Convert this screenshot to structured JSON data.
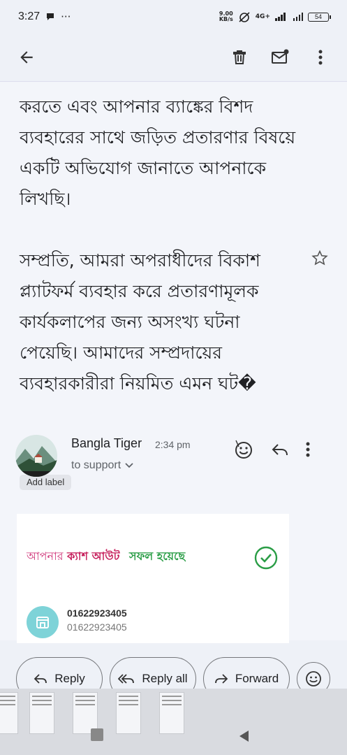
{
  "status_bar": {
    "time": "3:27",
    "ellipsis": "···",
    "speed_value": "9.00",
    "speed_unit": "KB/s",
    "network": "4G+",
    "battery": "54"
  },
  "email": {
    "paragraph_1": "করতে এবং আপনার ব্যাঙ্কের বিশদ ব্যবহারের সাথে জড়িত প্রতারণার বিষয়ে একটি অভিযোগ জানাতে আপনাকে লিখছি।",
    "paragraph_2": "সম্প্রতি, আমরা অপরাধীদের বিকাশ প্ল্যাটফর্ম ব্যবহার করে প্রতারণামূলক কার্যকলাপের জন্য অসংখ্য ঘটনা পেয়েছি। আমাদের সম্প্রদায়ের ব্যবহারকারীরা নিয়মিত এমন ঘট�",
    "add_label": "Add label"
  },
  "reply": {
    "sender_name": "Bangla Tiger",
    "time": "2:34 pm",
    "recipient": "to support"
  },
  "card": {
    "title_part1": "আপনার",
    "title_part2": "ক্যাশ আউট",
    "title_part3": "সফল হয়েছে",
    "number_1": "01622923405",
    "number_2": "01622923405"
  },
  "actions": {
    "reply": "Reply",
    "reply_all": "Reply all",
    "forward": "Forward"
  },
  "colors": {
    "background": "#eef1f7",
    "accent_pink": "#c51c5a",
    "accent_green": "#2a9d46",
    "icon_teal": "#7ed3d8"
  }
}
